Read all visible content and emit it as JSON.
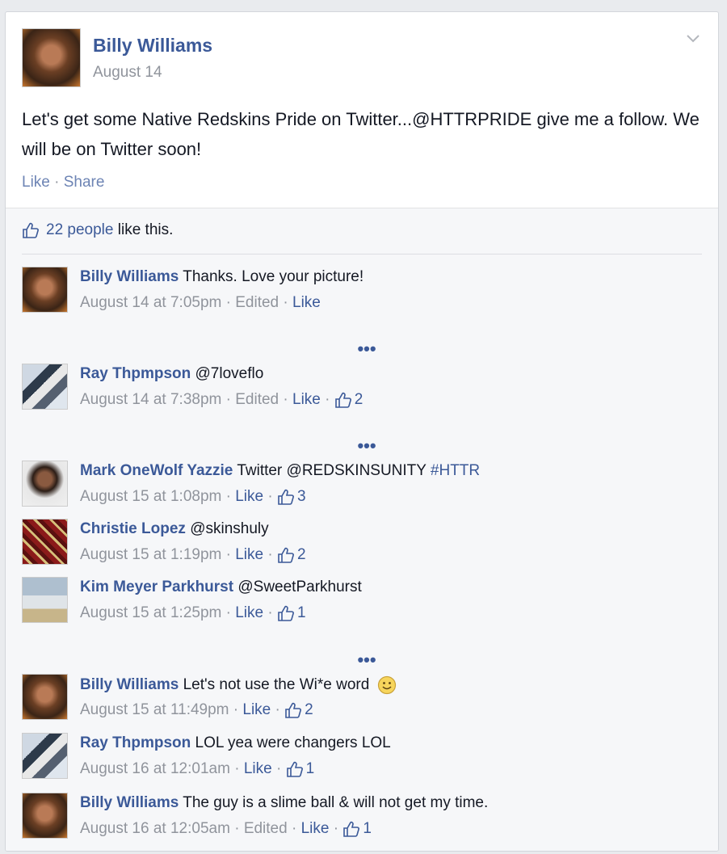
{
  "post": {
    "author": "Billy Williams",
    "date": "August 14",
    "text": "Let's get some Native Redskins Pride on Twitter...@HTTRPRIDE give me a follow. We will be on Twitter soon!",
    "like_label": "Like",
    "share_label": "Share",
    "dot": "·"
  },
  "likes": {
    "count": "22 people",
    "suffix": "like this."
  },
  "more_label": "•••",
  "comments": [
    {
      "name": "Billy Williams",
      "text": "Thanks. Love your picture!",
      "time": "August 14 at 7:05pm",
      "edited": "Edited",
      "like": "Like",
      "likes": ""
    },
    {
      "name": "Ray Thpmpson",
      "text": "@7loveflo",
      "time": "August 14 at 7:38pm",
      "edited": "Edited",
      "like": "Like",
      "likes": "2"
    },
    {
      "name": "Mark OneWolf Yazzie",
      "text": "Twitter @REDSKINSUNITY",
      "hashtag": "#HTTR",
      "time": "August 15 at 1:08pm",
      "like": "Like",
      "likes": "3"
    },
    {
      "name": "Christie Lopez",
      "text": "@skinshuly",
      "time": "August 15 at 1:19pm",
      "like": "Like",
      "likes": "2"
    },
    {
      "name": "Kim Meyer Parkhurst",
      "text": "@SweetParkhurst",
      "time": "August 15 at 1:25pm",
      "like": "Like",
      "likes": "1"
    },
    {
      "name": "Billy Williams",
      "text": "Let's not use the Wi*e word",
      "time": "August 15 at 11:49pm",
      "like": "Like",
      "likes": "2"
    },
    {
      "name": "Ray Thpmpson",
      "text": "LOL yea were changers LOL",
      "time": "August 16 at 12:01am",
      "like": "Like",
      "likes": "1"
    },
    {
      "name": "Billy Williams",
      "text": "The guy is a slime ball & will not get my time.",
      "time": "August 16 at 12:05am",
      "edited": "Edited",
      "like": "Like",
      "likes": "1"
    }
  ],
  "colors": {
    "link": "#3b5998",
    "muted": "#90949c",
    "background": "#e9ebee"
  },
  "icons": [
    "chevron-down-icon",
    "thumbs-up-icon",
    "smiley-icon",
    "more-dots-icon"
  ]
}
